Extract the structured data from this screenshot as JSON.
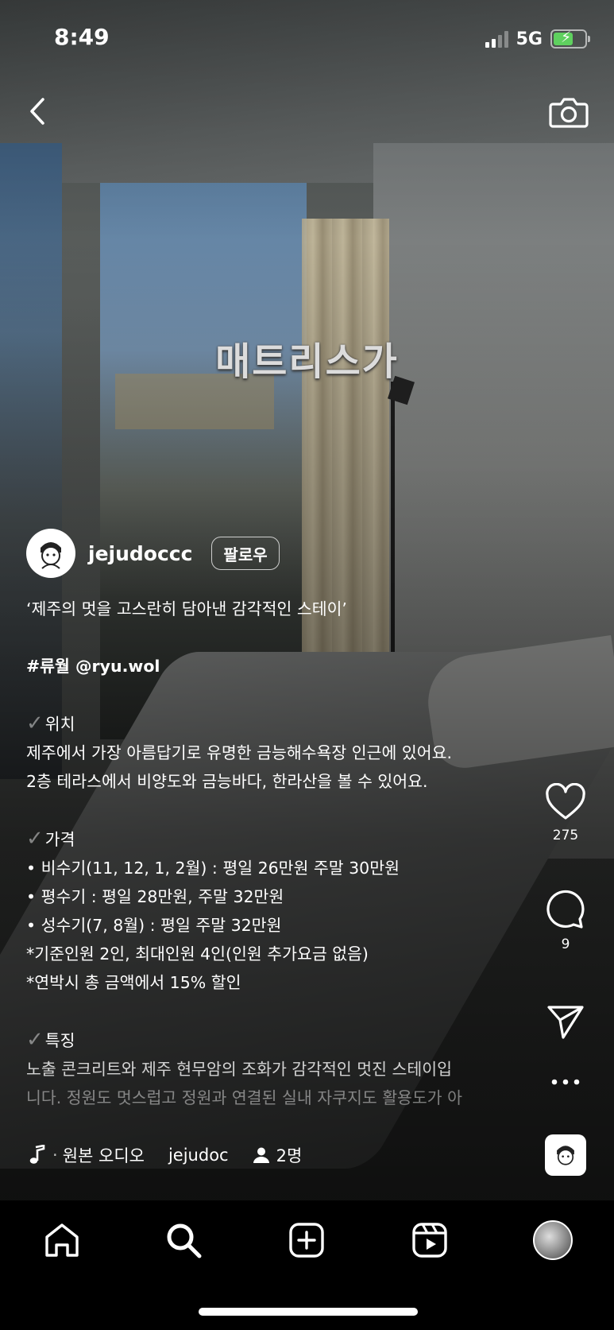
{
  "status_bar": {
    "time": "8:49",
    "network": "5G"
  },
  "overlay_text": "매트리스가",
  "author": {
    "username": "jejudoccc",
    "follow_label": "팔로우"
  },
  "caption": {
    "tagline": "‘제주의 멋을 고스란히 담아낸 감각적인 스테이’",
    "tags": "#류월 @ryu.wol",
    "location_heading": "위치",
    "location_line1": " 제주에서 가장 아름답기로 유명한 금능해수욕장 인근에 있어요.",
    "location_line2": "2층 테라스에서 비양도와 금능바다, 한라산을 볼 수 있어요.",
    "price_heading": "가격",
    "price_items": [
      "• 비수기(11, 12, 1, 2월) : 평일 26만원 주말 30만원",
      "• 평수기 : 평일 28만원, 주말 32만원",
      "• 성수기(7, 8월) : 평일 주말 32만원"
    ],
    "price_note1": "*기준인원 2인, 최대인원 4인(인원 추가요금 없음)",
    "price_note2": "*연박시 총 금액에서 15% 할인",
    "feature_heading": "특징",
    "feature_line1": " 노출 콘크리트와 제주 현무암의 조화가 감각적인 멋진 스테이입",
    "feature_line2": "니다. 정원도 멋스럽고 정원과 연결된 실내 자쿠지도 활용도가 아"
  },
  "actions": {
    "like_count": "275",
    "comment_count": "9"
  },
  "audio": {
    "label": "원본 오디오",
    "user": "jejudoc",
    "people": "2명"
  },
  "icons": {
    "back": "chevron-left-icon",
    "camera": "camera-icon",
    "like": "heart-icon",
    "comment": "comment-icon",
    "share": "paper-plane-icon",
    "more": "more-icon",
    "music": "music-note-icon",
    "person": "person-icon",
    "home": "home-icon",
    "search": "search-icon",
    "create": "plus-square-icon",
    "reels": "reels-icon",
    "profile": "profile-avatar-icon"
  },
  "colors": {
    "battery": "#5fd05f",
    "nav_bg": "#000000"
  }
}
